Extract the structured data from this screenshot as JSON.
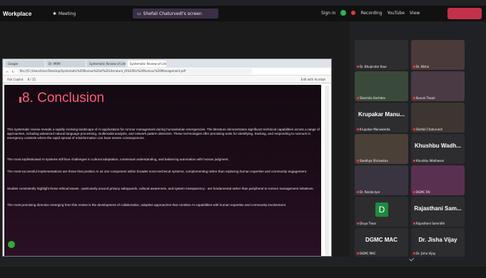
{
  "teams": {
    "app": "Workplace",
    "meeting": "Meeting",
    "screen_share": "Shefali Chaturvedi's screen",
    "sign_in": "Sign in",
    "recording": "Recording",
    "youtube": "YouTube",
    "view": "View"
  },
  "browser": {
    "tabs": [
      "Google",
      "Dr. MRM",
      "Systematic Review of Literature",
      "Systematic Review of Literature"
    ],
    "url": "file:///C:/Users/User/Desktop/Systematic%20Review%20of%20Literature_AI%20for%20Rumour%20Management.pdf",
    "zoom": "Ask Copilot",
    "page_counter": "8 / 15",
    "edit_label": "Edit with Acrobat"
  },
  "document": {
    "heading": "8. Conclusion",
    "paragraphs": [
      "This systematic review reveals a rapidly evolving landscape of AI applications for rumour management during humanitarian emergencies. The literature demonstrates significant technical capabilities across a range of approaches, including advanced natural language processing, multimodal analysis, and network pattern detection. These technologies offer promising tools for identifying, tracking, and responding to rumours in emergency contexts where the rapid spread of misinformation can have severe consequences.",
      "The most sophisticated AI systems still face challenges in cultural adaptation, contextual understanding, and balancing automation with human judgment.",
      "The most successful implementations are those that position AI as one component within broader socio-technical systems, complementing rather than replacing human expertise and community engagement.",
      "Studies consistently highlight those ethical issues - particularly around privacy safeguards, cultural awareness, and system transparency - are fundamental rather than peripheral to rumour management initiatives.",
      "The most promising direction emerging from this review is the development of collaborative, adaptive approaches that combine AI capabilities with human expertise and community involvement."
    ]
  },
  "participants": [
    {
      "label": "Dr. Bhupinder Kaur",
      "big": ""
    },
    {
      "label": "Dr. Nisha",
      "big": ""
    },
    {
      "label": "Sharmila Sachdev",
      "big": ""
    },
    {
      "label": "Kusum Tiwari",
      "big": ""
    },
    {
      "label": "Krupakar Manukonda",
      "big": "Krupakar Manu..."
    },
    {
      "label": "Shefali Chaturvedi",
      "big": ""
    },
    {
      "label": "Sandhya Shrivastav",
      "big": ""
    },
    {
      "label": "Khushbu Wadhwani",
      "big": "Khushbu Wadh..."
    },
    {
      "label": "Dr. Renita Iyer",
      "big": ""
    },
    {
      "label": "DGMC FAI",
      "big": ""
    },
    {
      "label": "Divya Tiwai",
      "big": "",
      "avatar": "D"
    },
    {
      "label": "Rajasthani Samridhi",
      "big": "Rajasthani Sam..."
    },
    {
      "label": "DGMC MAC",
      "big": "DGMC MAC"
    },
    {
      "label": "Dr. Jisha Vijay",
      "big": "Dr. Jisha Vijay"
    }
  ],
  "colors": {
    "heading": "#ff5a7a",
    "teams_bar": "#111111",
    "record": "#e23b3b",
    "online": "#2fb34a"
  }
}
